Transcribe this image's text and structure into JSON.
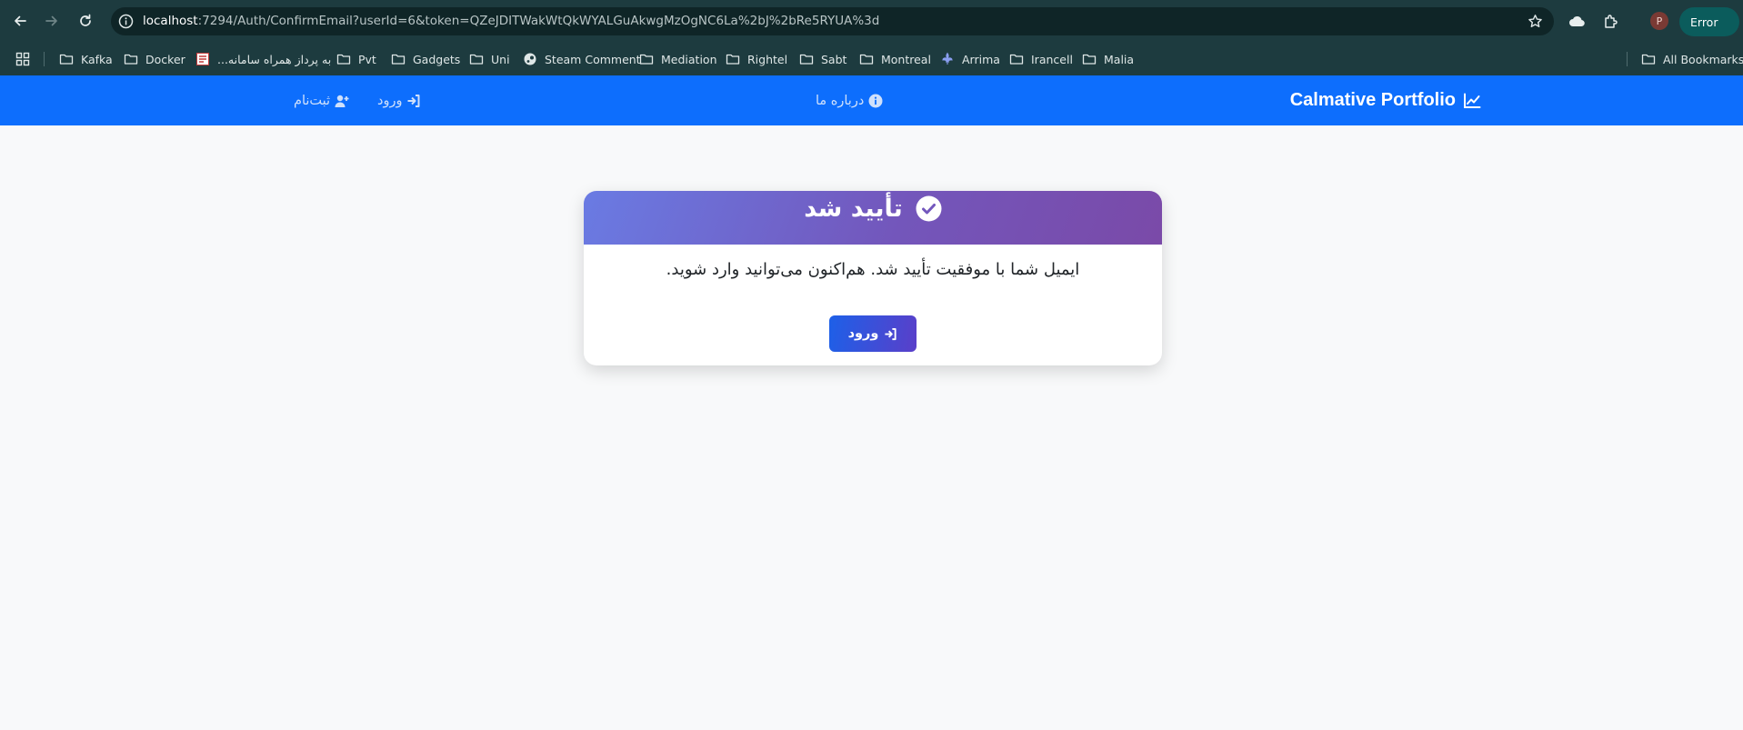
{
  "browser": {
    "url_host": "localhost",
    "url_rest": ":7294/Auth/ConfirmEmail?userId=6&token=QZeJDITWakWtQkWYALGuAkwgMzOgNC6La%2bJ%2bRe5RYUA%3d",
    "profile_initial": "P",
    "error_label": "Error"
  },
  "bookmarks": [
    {
      "label": "Kafka",
      "icon": "folder-icon"
    },
    {
      "label": "Docker",
      "icon": "folder-icon"
    },
    {
      "label": "به پرداز همراه سامانه...",
      "icon": "site-favicon"
    },
    {
      "label": "Pvt",
      "icon": "folder-icon"
    },
    {
      "label": "Gadgets",
      "icon": "folder-icon"
    },
    {
      "label": "Uni",
      "icon": "folder-icon"
    },
    {
      "label": "Steam Comment",
      "icon": "steam-icon"
    },
    {
      "label": "Mediation",
      "icon": "folder-icon"
    },
    {
      "label": "Rightel",
      "icon": "folder-icon"
    },
    {
      "label": "Sabt",
      "icon": "folder-icon"
    },
    {
      "label": "Montreal",
      "icon": "folder-icon"
    },
    {
      "label": "Arrima",
      "icon": "fleur-de-lis-icon"
    },
    {
      "label": "Irancell",
      "icon": "folder-icon"
    },
    {
      "label": "Malia",
      "icon": "folder-icon"
    }
  ],
  "all_bookmarks_label": "All Bookmarks",
  "navbar": {
    "brand": "Calmative Portfolio",
    "about": "درباره ما",
    "login": "ورود",
    "register": "ثبت‌نام"
  },
  "card": {
    "title": "تأیید شد",
    "message": "ایمیل شما با موفقیت تأیید شد. هم‌اکنون می‌توانید وارد شوید.",
    "button": "ورود"
  },
  "colors": {
    "navbar": "#0d6efd",
    "header_gradient_start": "#6a7be3",
    "header_gradient_end": "#7a4aa8",
    "page_bg": "#f8f9fa"
  }
}
